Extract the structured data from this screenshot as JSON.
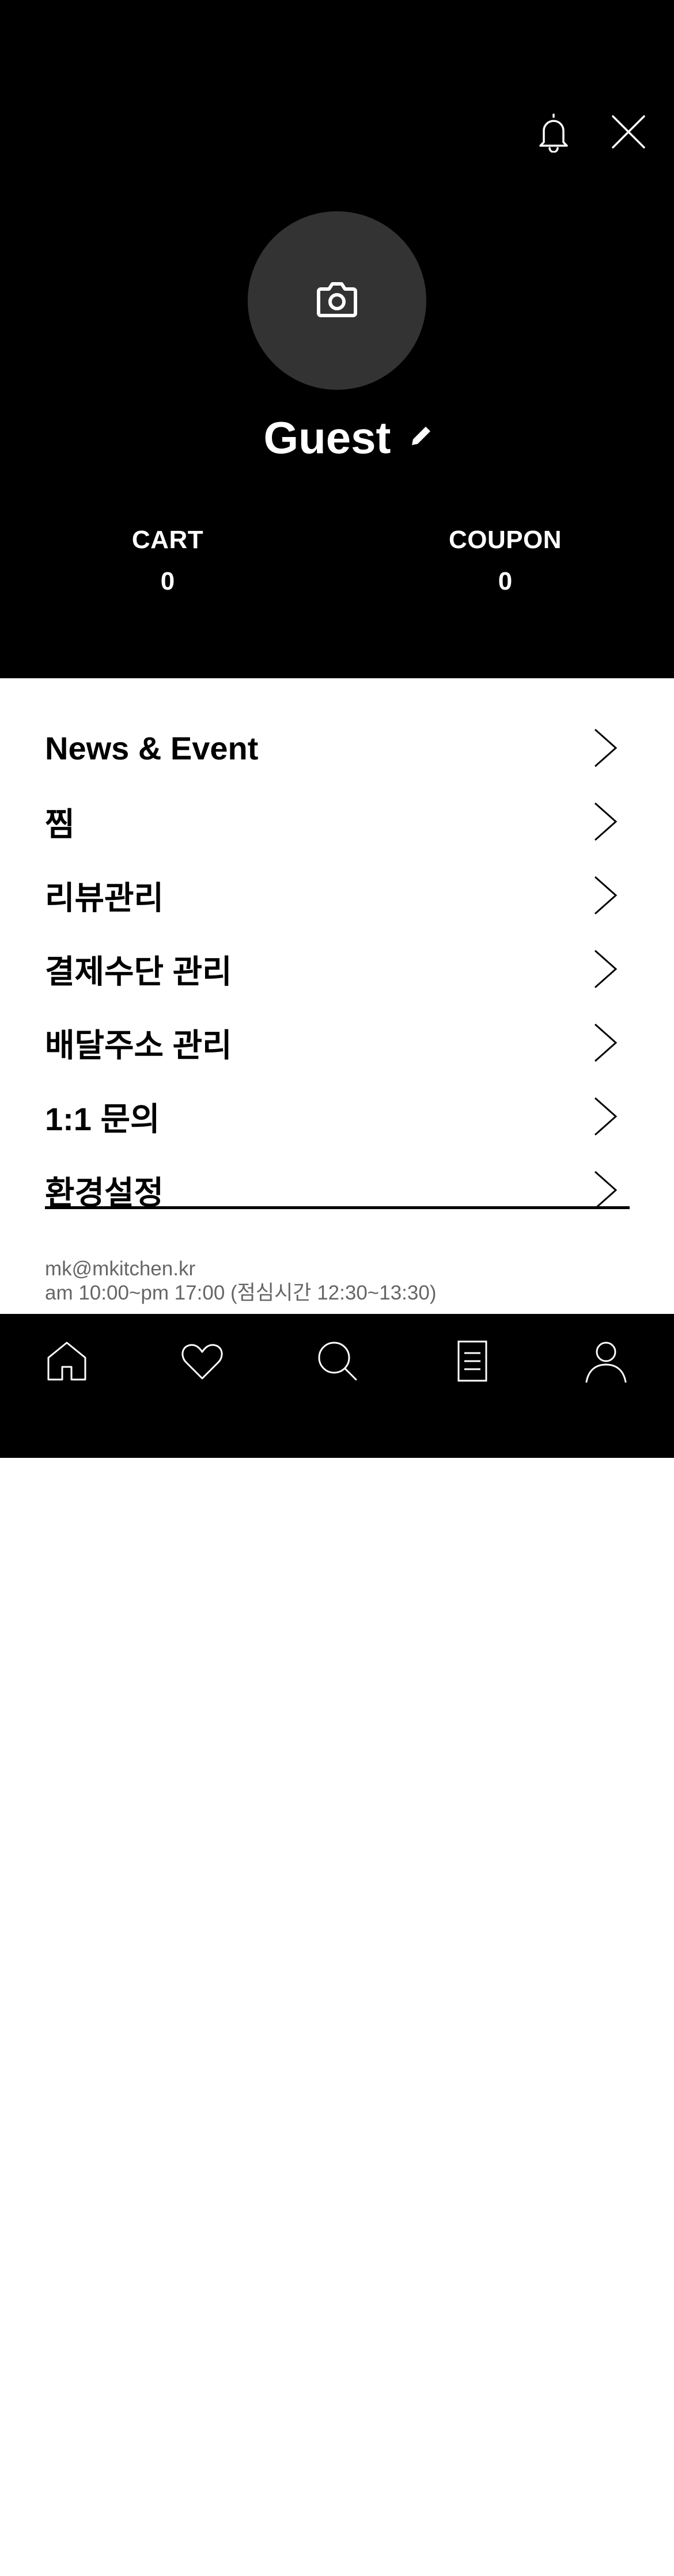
{
  "header": {
    "profile_name": "Guest",
    "stats": [
      {
        "label": "CART",
        "value": "0"
      },
      {
        "label": "COUPON",
        "value": "0"
      }
    ]
  },
  "menu": {
    "items": [
      {
        "label": "News & Event"
      },
      {
        "label": "찜"
      },
      {
        "label": "리뷰관리"
      },
      {
        "label": "결제수단 관리"
      },
      {
        "label": "배달주소 관리"
      },
      {
        "label": "1:1 문의"
      },
      {
        "label": "환경설정"
      }
    ]
  },
  "footer": {
    "email": "mk@mkitchen.kr",
    "hours": "am 10:00~pm 17:00 (점심시간 12:30~13:30)"
  },
  "tabbar": {
    "icons": [
      "home-icon",
      "heart-icon",
      "search-icon",
      "document-icon",
      "person-icon"
    ]
  },
  "colors": {
    "header_bg": "#000000",
    "avatar_bg": "#333333",
    "footer_text": "#666666"
  }
}
